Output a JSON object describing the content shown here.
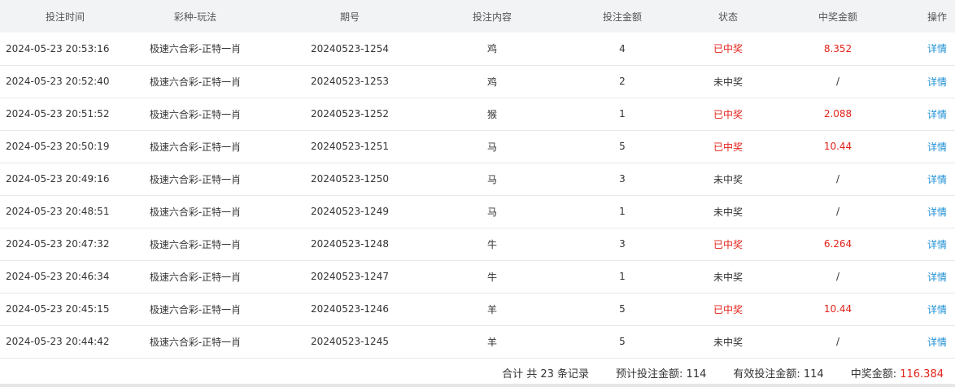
{
  "columns": [
    "投注时间",
    "彩种-玩法",
    "期号",
    "投注内容",
    "投注金额",
    "状态",
    "中奖金额",
    "操作"
  ],
  "rows": [
    {
      "time": "2024-05-23 20:53:16",
      "game": "极速六合彩-正特一肖",
      "issue": "20240523-1254",
      "content": "鸡",
      "amount": "4",
      "status": "已中奖",
      "won": true,
      "prize": "8.352",
      "action": "详情"
    },
    {
      "time": "2024-05-23 20:52:40",
      "game": "极速六合彩-正特一肖",
      "issue": "20240523-1253",
      "content": "鸡",
      "amount": "2",
      "status": "未中奖",
      "won": false,
      "prize": "/",
      "action": "详情"
    },
    {
      "time": "2024-05-23 20:51:52",
      "game": "极速六合彩-正特一肖",
      "issue": "20240523-1252",
      "content": "猴",
      "amount": "1",
      "status": "已中奖",
      "won": true,
      "prize": "2.088",
      "action": "详情"
    },
    {
      "time": "2024-05-23 20:50:19",
      "game": "极速六合彩-正特一肖",
      "issue": "20240523-1251",
      "content": "马",
      "amount": "5",
      "status": "已中奖",
      "won": true,
      "prize": "10.44",
      "action": "详情"
    },
    {
      "time": "2024-05-23 20:49:16",
      "game": "极速六合彩-正特一肖",
      "issue": "20240523-1250",
      "content": "马",
      "amount": "3",
      "status": "未中奖",
      "won": false,
      "prize": "/",
      "action": "详情"
    },
    {
      "time": "2024-05-23 20:48:51",
      "game": "极速六合彩-正特一肖",
      "issue": "20240523-1249",
      "content": "马",
      "amount": "1",
      "status": "未中奖",
      "won": false,
      "prize": "/",
      "action": "详情"
    },
    {
      "time": "2024-05-23 20:47:32",
      "game": "极速六合彩-正特一肖",
      "issue": "20240523-1248",
      "content": "牛",
      "amount": "3",
      "status": "已中奖",
      "won": true,
      "prize": "6.264",
      "action": "详情"
    },
    {
      "time": "2024-05-23 20:46:34",
      "game": "极速六合彩-正特一肖",
      "issue": "20240523-1247",
      "content": "牛",
      "amount": "1",
      "status": "未中奖",
      "won": false,
      "prize": "/",
      "action": "详情"
    },
    {
      "time": "2024-05-23 20:45:15",
      "game": "极速六合彩-正特一肖",
      "issue": "20240523-1246",
      "content": "羊",
      "amount": "5",
      "status": "已中奖",
      "won": true,
      "prize": "10.44",
      "action": "详情"
    },
    {
      "time": "2024-05-23 20:44:42",
      "game": "极速六合彩-正特一肖",
      "issue": "20240523-1245",
      "content": "羊",
      "amount": "5",
      "status": "未中奖",
      "won": false,
      "prize": "/",
      "action": "详情"
    }
  ],
  "footer": {
    "total_records": "合计 共 23 条记录",
    "expected_label": "预计投注金额: ",
    "expected_value": "114",
    "effective_label": "有效投注金额: ",
    "effective_value": "114",
    "prize_label": "中奖金额: ",
    "prize_value": "116.384"
  },
  "colors": {
    "won": "#e2231a",
    "link": "#1e90d6",
    "header_bg": "#f2f3f5"
  }
}
